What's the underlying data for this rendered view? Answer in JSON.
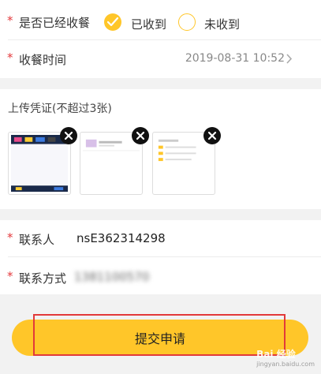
{
  "received": {
    "label": "是否已经收餐",
    "option_yes": "已收到",
    "option_no": "未收到",
    "selected": "已收到"
  },
  "receive_time": {
    "label": "收餐时间",
    "value": "2019-08-31 10:52"
  },
  "upload": {
    "title": "上传凭证(不超过3张)",
    "thumbnails": 3
  },
  "contact": {
    "name_label": "联系人",
    "name_value": "nsE362314298",
    "phone_label": "联系方式",
    "phone_value": "1381100570"
  },
  "submit_label": "提交申请",
  "required_mark": "*",
  "watermark": {
    "text": "Bai 经验",
    "sub": "jingyan.baidu.com"
  },
  "colors": {
    "accent": "#ffc629",
    "required": "#e4393c",
    "highlight": "#e23a3a"
  }
}
